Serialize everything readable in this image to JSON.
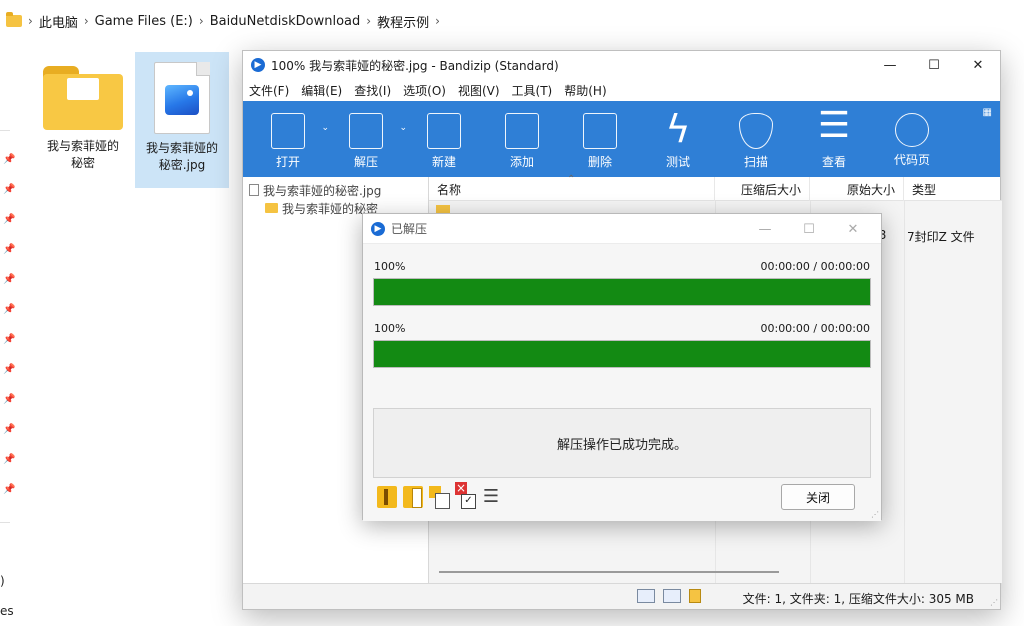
{
  "explorer": {
    "breadcrumb": [
      "此电脑",
      "Game Files (E:)",
      "BaiduNetdiskDownload",
      "教程示例"
    ],
    "files": [
      {
        "name_line1": "我与索菲娅的",
        "name_line2": "秘密"
      },
      {
        "name_line1": "我与索菲娅的",
        "name_line2": "秘密.jpg"
      }
    ],
    "rail_text": [
      ")",
      "es"
    ]
  },
  "bandizip": {
    "title": "100% 我与索菲娅的秘密.jpg - Bandizip (Standard)",
    "app_badge": "▶",
    "window_controls": {
      "minimize": "—",
      "maximize": "☐",
      "close": "✕"
    },
    "menu": [
      "文件(F)",
      "编辑(E)",
      "查找(I)",
      "选项(O)",
      "视图(V)",
      "工具(T)",
      "帮助(H)"
    ],
    "toolbar": [
      {
        "label": "打开",
        "icon": "open-icon"
      },
      {
        "label": "解压",
        "icon": "extract-icon"
      },
      {
        "label": "新建",
        "icon": "new-archive-icon"
      },
      {
        "label": "添加",
        "icon": "add-icon"
      },
      {
        "label": "删除",
        "icon": "delete-icon"
      },
      {
        "label": "测试",
        "icon": "test-icon"
      },
      {
        "label": "扫描",
        "icon": "scan-icon"
      },
      {
        "label": "查看",
        "icon": "view-icon"
      },
      {
        "label": "代码页",
        "icon": "codepage-icon"
      }
    ],
    "dropdown_arrow": "⌄",
    "tree": [
      {
        "label": "我与索菲娅的秘密.jpg"
      },
      {
        "label": "我与索菲娅的秘密"
      }
    ],
    "columns": {
      "name": "名称",
      "sort_arrow": "⌃",
      "packed": "压缩后大小",
      "original": "原始大小",
      "type": "类型"
    },
    "row_tail": {
      "original_size_tail": "28",
      "type": "7封印Z 文件"
    },
    "status": "文件: 1, 文件夹: 1, 压缩文件大小: 305 MB"
  },
  "dialog": {
    "title": "已解压",
    "progress": [
      {
        "label": "100%",
        "time": "00:00:00 / 00:00:00",
        "value": 1.0
      },
      {
        "label": "100%",
        "time": "00:00:00 / 00:00:00",
        "value": 1.0
      }
    ],
    "message": "解压操作已成功完成。",
    "close_label": "关闭"
  },
  "colors": {
    "toolbar": "#2f7fd6",
    "progress": "#138a13"
  }
}
